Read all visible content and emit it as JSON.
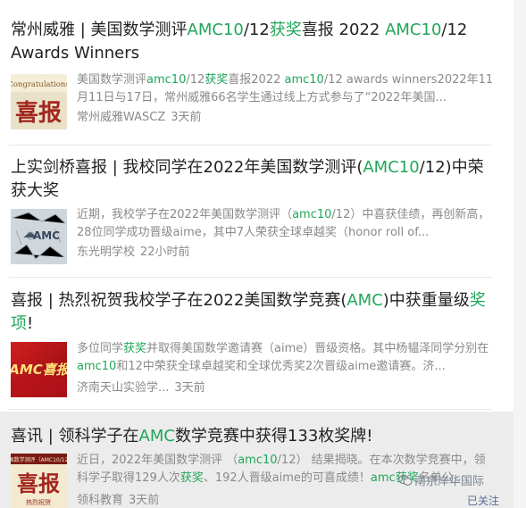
{
  "articles": [
    {
      "title": [
        {
          "t": "常州威雅 |  美国数学测评"
        },
        {
          "t": "AMC10",
          "h": true
        },
        {
          "t": "/12"
        },
        {
          "t": "获奖",
          "h": true
        },
        {
          "t": "喜报 2022 "
        },
        {
          "t": "AMC10",
          "h": true
        },
        {
          "t": "/12 Awards Winners"
        }
      ],
      "snippet": [
        {
          "t": "美国数学测评"
        },
        {
          "t": "amc10",
          "h": true
        },
        {
          "t": "/12"
        },
        {
          "t": "获奖",
          "h": true
        },
        {
          "t": "喜报2022 "
        },
        {
          "t": "amc10",
          "h": true
        },
        {
          "t": "/12 awards winners2022年11月11日与17日，常州威雅66名学生通过线上方式参与了“2022年美国..."
        }
      ],
      "source": "常州威雅WASCZ",
      "time": "3天前",
      "thumb_text": {
        "top": "Congratulations",
        "main": "喜报"
      }
    },
    {
      "title": [
        {
          "t": "上实剑桥喜报 | 我校同学在2022年美国数学测评("
        },
        {
          "t": "AMC10",
          "h": true
        },
        {
          "t": "/12)中荣获大奖"
        }
      ],
      "snippet": [
        {
          "t": "近期，我校学子在2022年美国数学测评（"
        },
        {
          "t": "amc10",
          "h": true
        },
        {
          "t": "/12）中喜获佳绩，再创新高，28位同学成功晋级aime，其中7人荣获全球卓越奖（honor roll of..."
        }
      ],
      "source": "东光明学校",
      "time": "22小时前",
      "thumb_text": {
        "main": "AMC"
      }
    },
    {
      "title": [
        {
          "t": "喜报 | 热烈祝贺我校学子在2022美国数学竞赛("
        },
        {
          "t": "AMC",
          "h": true
        },
        {
          "t": ")中获重量级"
        },
        {
          "t": "奖项",
          "h": true
        },
        {
          "t": "!"
        }
      ],
      "snippet": [
        {
          "t": "多位同学"
        },
        {
          "t": "获奖",
          "h": true
        },
        {
          "t": "并取得美国数学邀请赛（aime）晋级资格。其中杨韫泽同学分别在"
        },
        {
          "t": "amc10",
          "h": true
        },
        {
          "t": "和12中荣获全球卓越奖和全球优秀奖2次晋级aime邀请赛。济..."
        }
      ],
      "source": "济南天山实验学...",
      "time": "3天前",
      "thumb_text": {
        "main": "AMC喜报"
      }
    },
    {
      "title": [
        {
          "t": "喜讯 | 领科学子在"
        },
        {
          "t": "AMC",
          "h": true
        },
        {
          "t": "数学竞赛中获得133枚奖牌!"
        }
      ],
      "snippet": [
        {
          "t": "近日，2022年美国数学测评 （"
        },
        {
          "t": "amc10",
          "h": true
        },
        {
          "t": "/12） 结果揭晓。在本次数学竞赛中，领科学子取得129人次"
        },
        {
          "t": "获奖",
          "h": true
        },
        {
          "t": "、192人晋级aime的可喜成绩！"
        },
        {
          "t": "amc",
          "h": true
        },
        {
          "t": "获奖",
          "h": true
        },
        {
          "t": "名单公..."
        }
      ],
      "source": "领科教育",
      "time": "3天前",
      "thumb_text": {
        "top": "美国数学测评（AMC10/12）",
        "main": "喜报",
        "bottom": "热烈祝贺"
      }
    }
  ],
  "watermark": {
    "text": "南京岸华国际",
    "icon": "wechat-icon"
  },
  "followed_label": "已关注",
  "colors": {
    "highlight": "#21a65a",
    "meta": "#8a8a8a",
    "followed": "#576b95"
  }
}
